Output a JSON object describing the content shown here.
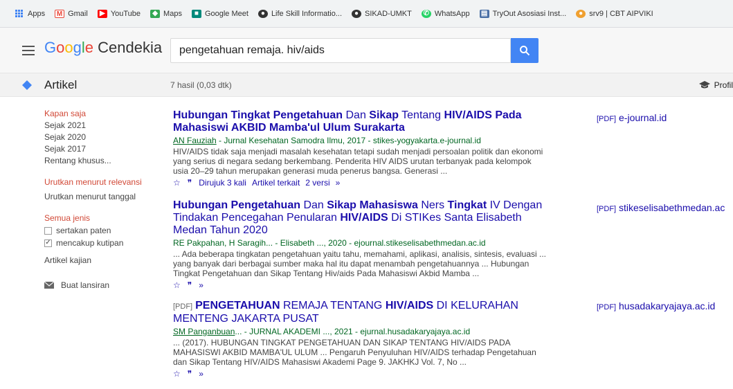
{
  "bookmarks": [
    {
      "label": "Apps",
      "icon": "apps-grid-icon",
      "color": "#4285f4"
    },
    {
      "label": "Gmail",
      "icon": "gmail-icon",
      "color": "#ea4335"
    },
    {
      "label": "YouTube",
      "icon": "youtube-icon",
      "color": "#ff0000"
    },
    {
      "label": "Maps",
      "icon": "maps-icon",
      "color": "#34a853"
    },
    {
      "label": "Google Meet",
      "icon": "meet-icon",
      "color": "#00897b"
    },
    {
      "label": "Life Skill Informatio...",
      "icon": "globe-icon",
      "color": "#333333"
    },
    {
      "label": "SIKAD-UMKT",
      "icon": "globe-icon",
      "color": "#333333"
    },
    {
      "label": "WhatsApp",
      "icon": "whatsapp-icon",
      "color": "#25d366"
    },
    {
      "label": "TryOut Asosiasi Inst...",
      "icon": "folder-icon",
      "color": "#4a6fa5"
    },
    {
      "label": "srv9 | CBT AIPVIKI",
      "icon": "site-icon",
      "color": "#f0a030"
    }
  ],
  "header": {
    "logo_google": "Google",
    "logo_product": "Cendekia",
    "search_value": "pengetahuan remaja. hiv/aids"
  },
  "subheader": {
    "label": "Artikel",
    "result_count": "7 hasil (0,03 dtk)",
    "profile_label": "Profil"
  },
  "sidebar": {
    "time_filters": [
      "Kapan saja",
      "Sejak 2021",
      "Sejak 2020",
      "Sejak 2017",
      "Rentang khusus..."
    ],
    "sort": [
      "Urutkan menurut relevansi",
      "Urutkan menurut tanggal"
    ],
    "type_label": "Semua jenis",
    "include_patents": "sertakan paten",
    "include_citations": "mencakup kutipan",
    "review_articles": "Artikel kajian",
    "create_alert": "Buat lansiran"
  },
  "results": [
    {
      "type_tag": "",
      "title_parts": [
        {
          "t": "Hubungan Tingkat Pengetahuan",
          "b": true
        },
        {
          "t": " Dan ",
          "b": false
        },
        {
          "t": "Sikap",
          "b": true
        },
        {
          "t": " Tentang ",
          "b": false
        },
        {
          "t": "HIV/AIDS Pada Mahasiswi AKBID Mamba'ul Ulum Surakarta",
          "b": true
        }
      ],
      "author": "AN Fauziah",
      "meta": " - Jurnal Kesehatan Samodra Ilmu, 2017 - stikes-yogyakarta.e-journal.id",
      "snippet": "HIV/AIDS tidak saja menjadi masalah kesehatan tetapi sudah menjadi persoalan politik dan ekonomi yang serius di negara sedang berkembang. Penderita HIV AIDS urutan terbanyak pada kelompok usia 20–29 tahun merupakan generasi muda penerus bangsa. Generasi ...",
      "links": [
        "Dirujuk 3 kali",
        "Artikel terkait",
        "2 versi"
      ],
      "pdf_side": "e-journal.id"
    },
    {
      "type_tag": "",
      "title_parts": [
        {
          "t": "Hubungan Pengetahuan",
          "b": true
        },
        {
          "t": " Dan ",
          "b": false
        },
        {
          "t": "Sikap Mahasiswa",
          "b": true
        },
        {
          "t": " Ners ",
          "b": false
        },
        {
          "t": "Tingkat",
          "b": true
        },
        {
          "t": " IV Dengan Tindakan Pencegahan Penularan ",
          "b": false
        },
        {
          "t": "HIV/AIDS",
          "b": true
        },
        {
          "t": " Di STIKes Santa Elisabeth Medan Tahun 2020",
          "b": false
        }
      ],
      "author": "",
      "meta": "RE Pakpahan, H Saragih... - Elisabeth ..., 2020 - ejournal.stikeselisabethmedan.ac.id",
      "snippet": "... Ada beberapa tingkatan pengetahuan yaitu tahu, memahami, aplikasi, analisis, sintesis, evaluasi ... yang banyak dari berbagai sumber maka hal itu dapat menambah pengetahuannya ... Hubungan Tingkat Pengetahuan dan Sikap Tentang Hiv/aids Pada Mahasiswi Akbid Mamba ...",
      "links": [],
      "pdf_side": "stikeselisabethmedan.ac"
    },
    {
      "type_tag": "[PDF]",
      "title_parts": [
        {
          "t": "PENGETAHUAN",
          "b": true
        },
        {
          "t": " REMAJA TENTANG ",
          "b": false
        },
        {
          "t": "HIV/AIDS",
          "b": true
        },
        {
          "t": " DI KELURAHAN MENTENG JAKARTA PUSAT",
          "b": false
        }
      ],
      "author": "SM Panganbuan",
      "meta": "... - JURNAL AKADEMI ..., 2021 - ejurnal.husadakaryajaya.ac.id",
      "snippet": "... (2017). HUBUNGAN TINGKAT PENGETAHUAN DAN SIKAP TENTANG HIV/AIDS PADA MAHASISWI AKBID MAMBA'UL ULUM ... Pengaruh Penyuluhan HIV/AIDS terhadap Pengetahuan dan Sikap Tentang HIV/AIDS Mahasiswi Akademi Page 9. JAKHKJ Vol. 7, No ...",
      "links": [],
      "pdf_side": "husadakaryajaya.ac.id"
    }
  ],
  "pdf_tag": "[PDF]",
  "colors": {
    "link": "#1a0dab",
    "meta": "#006621",
    "accent": "#4285f4",
    "selected": "#d14836"
  }
}
